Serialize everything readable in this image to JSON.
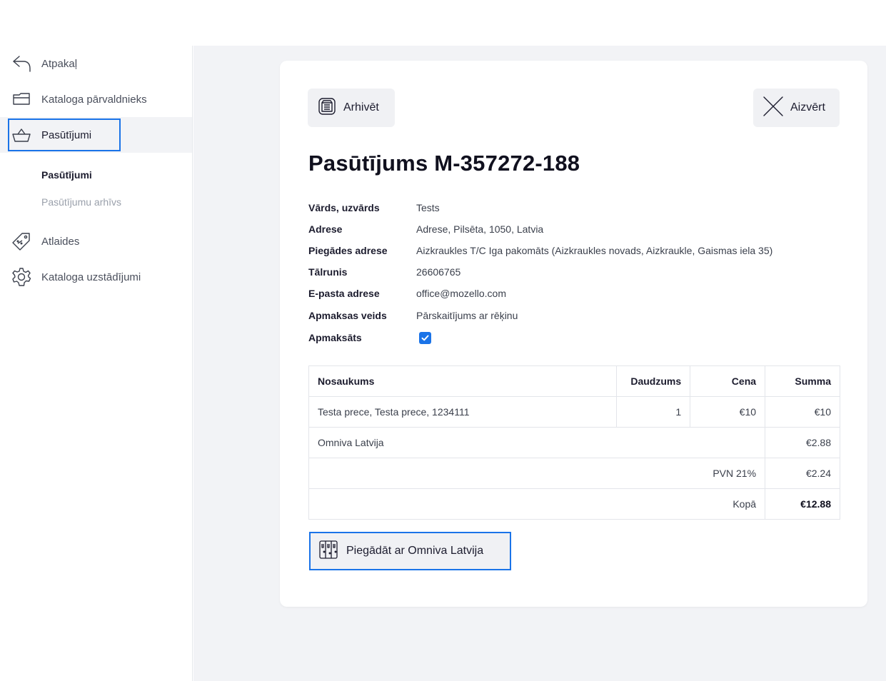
{
  "sidebar": {
    "back_label": "Atpakaļ",
    "catalog_manager_label": "Kataloga pārvaldnieks",
    "orders_label": "Pasūtījumi",
    "sub_orders_label": "Pasūtījumi",
    "sub_archive_label": "Pasūtījumu arhīvs",
    "discounts_label": "Atlaides",
    "catalog_settings_label": "Kataloga uzstādījumi"
  },
  "toolbar": {
    "archive_label": "Arhivēt",
    "close_label": "Aizvērt"
  },
  "order": {
    "title": "Pasūtījums M-357272-188",
    "fields": [
      {
        "label": "Vārds, uzvārds",
        "value": "Tests"
      },
      {
        "label": "Adrese",
        "value": "Adrese, Pilsēta, 1050, Latvia"
      },
      {
        "label": "Piegādes adrese",
        "value": "Aizkraukles T/C Iga pakomāts (Aizkraukles novads, Aizkraukle, Gaismas iela 35)"
      },
      {
        "label": "Tālrunis",
        "value": "26606765"
      },
      {
        "label": "E-pasta adrese",
        "value": "office@mozello.com"
      },
      {
        "label": "Apmaksas veids",
        "value": "Pārskaitījums ar rēķinu"
      },
      {
        "label": "Apmaksāts",
        "value": ""
      }
    ],
    "paid": true
  },
  "table": {
    "headers": {
      "name": "Nosaukums",
      "qty": "Daudzums",
      "price": "Cena",
      "sum": "Summa"
    },
    "item": {
      "name": "Testa prece, Testa prece, 1234111",
      "qty": "1",
      "price": "€10",
      "sum": "€10"
    },
    "shipping": {
      "name": "Omniva Latvija",
      "sum": "€2.88"
    },
    "vat": {
      "label": "PVN 21%",
      "sum": "€2.24"
    },
    "total": {
      "label": "Kopā",
      "sum": "€12.88"
    }
  },
  "ship_button_label": "Piegādāt ar Omniva Latvija",
  "colors": {
    "accent": "#1a73e8",
    "background": "#f2f3f6"
  }
}
